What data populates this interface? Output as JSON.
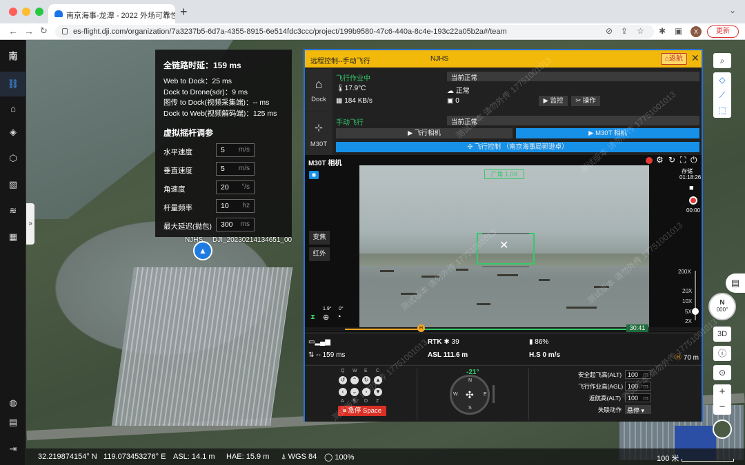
{
  "browser": {
    "tab_title": "南京海事-龙潭 - 2022 外场可靠性",
    "url": "es-flight.dji.com/organization/7a3237b5-6d7a-4355-8915-6e514fdc3ccc/project/199b9580-47c6-440a-8c4e-193c22a05b2a#/team",
    "avatar_letter": "X",
    "update_label": "更新"
  },
  "sidebar": {
    "top_label": "南",
    "items": [
      "team-icon",
      "map-pin-icon",
      "layers-icon",
      "model-icon",
      "media-icon",
      "flight-icon",
      "calendar-icon"
    ],
    "bottom": [
      "globe-icon",
      "document-icon",
      "logout-icon"
    ]
  },
  "latency": {
    "title": "全链路时延：159 ms",
    "rows": [
      "Web to Dock：25 ms",
      "Dock to Drone(sdr)：9 ms",
      "图传 to Dock(视频采集端)：-- ms",
      "Dock to Web(视频解码端)：125 ms"
    ],
    "tune_title": "虚拟摇杆调参",
    "params": [
      {
        "label": "水平速度",
        "value": "5",
        "unit": "m/s"
      },
      {
        "label": "垂直速度",
        "value": "5",
        "unit": "m/s"
      },
      {
        "label": "角速度",
        "value": "20",
        "unit": "°/s"
      },
      {
        "label": "杆量频率",
        "value": "10",
        "unit": "hz"
      },
      {
        "label": "最大延迟(抛包)",
        "value": "300",
        "unit": "ms"
      }
    ]
  },
  "map": {
    "marker_label": "NJHS",
    "media_label": "DJI_20230214134651_00",
    "scale": "100 米"
  },
  "panel": {
    "title": "远程控制--手动飞行",
    "device_name": "NJHS",
    "return_label": "返航",
    "dock": {
      "name": "Dock",
      "mode": "飞行作业中",
      "status": "当前正常",
      "temp": "17.9°C",
      "health": "正常",
      "net": "184 KB/s",
      "count": "0",
      "monitor_btn": "监控",
      "operate_btn": "操作"
    },
    "drone": {
      "name": "M30T",
      "mode": "手动飞行",
      "status": "当前正常",
      "fly_camera_btn": "飞行相机",
      "m30t_camera_btn": "M30T 相机",
      "control_btn": "飞行控制 （南京海事局郭逊卓）"
    },
    "camera": {
      "title": "M30T 相机",
      "storage": "存储",
      "storage_time": "01:18:26",
      "rec_time": "00:00",
      "wide": "广角 1.0X",
      "zoom_btn": "变焦",
      "ir_btn": "红外",
      "gimbal_pitch": "1.9°",
      "gimbal_yaw": "0°",
      "time_badge": "30:41",
      "zoom_levels": [
        "200X",
        "20X",
        "10X",
        "5X",
        "2X"
      ]
    },
    "telemetry": {
      "rtk": "RTK",
      "rtk_count": "39",
      "battery": "86%",
      "latency": "-- 159 ms",
      "asl": "ASL 111.6 m",
      "hs": "H.S 0 m/s",
      "home_dist": "70 m"
    },
    "controls": {
      "keys_top": [
        "Q",
        "W",
        "E",
        "C"
      ],
      "keys_bottom": [
        "A",
        "S",
        "D",
        "Z"
      ],
      "estop": "急停 Space",
      "heading": "-21°",
      "safe_alt_label": "安全起飞高(ALT)",
      "safe_alt": "100",
      "work_alt_label": "飞行作业高(AGL)",
      "work_alt": "100",
      "rth_alt_label": "返航高(ALT)",
      "rth_alt": "100",
      "unit": "m",
      "lost_label": "失联动作",
      "lost_value": "悬停"
    },
    "watermark": "测试版本 请勿外传 17751001013"
  },
  "right_tools": {
    "compass_n": "N",
    "compass_deg": "000°",
    "btn_3d": "3D"
  },
  "status": {
    "lat": "32.219874154° N",
    "lon": "119.073453276° E",
    "asl": "ASL: 14.1 m",
    "hae": "HAE: 15.9 m",
    "datum": "WGS 84",
    "zoom": "100%"
  },
  "colors": {
    "accent": "#1790e8",
    "header": "#f2b90b",
    "ok": "#35c96b",
    "danger": "#d93025"
  }
}
